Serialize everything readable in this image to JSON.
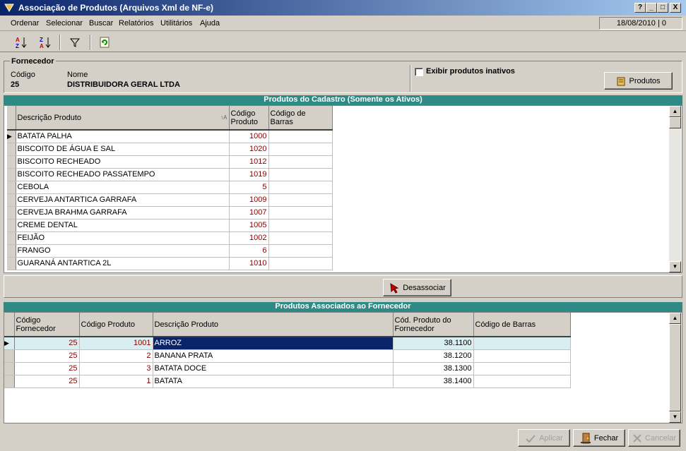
{
  "window": {
    "title": "Associação de Produtos (Arquivos Xml de NF-e)",
    "btn_help": "?",
    "btn_min": "_",
    "btn_max": "□",
    "btn_close": "X"
  },
  "menu": [
    "Ordenar",
    "Selecionar",
    "Buscar",
    "Relatórios",
    "Utilitários",
    "Ajuda"
  ],
  "status": {
    "date_user": "18/08/2010 | 0"
  },
  "fornecedor": {
    "group_label": "Fornecedor",
    "codigo_label": "Código",
    "codigo": "25",
    "nome_label": "Nome",
    "nome": "DISTRIBUIDORA GERAL LTDA",
    "inativos_label": "Exibir produtos inativos",
    "produtos_btn": "Produtos"
  },
  "cadastro": {
    "title": "Produtos do Cadastro (Somente os Ativos)",
    "headers": [
      "Descrição Produto",
      "Código Produto",
      "Código de Barras"
    ],
    "rows": [
      [
        "BATATA PALHA",
        "1000",
        ""
      ],
      [
        "BISCOITO DE ÁGUA E SAL",
        "1020",
        ""
      ],
      [
        "BISCOITO RECHEADO",
        "1012",
        ""
      ],
      [
        "BISCOITO RECHEADO PASSATEMPO",
        "1019",
        ""
      ],
      [
        "CEBOLA",
        "5",
        ""
      ],
      [
        "CERVEJA ANTARTICA GARRAFA",
        "1009",
        ""
      ],
      [
        "CERVEJA BRAHMA GARRAFA",
        "1007",
        ""
      ],
      [
        "CREME DENTAL",
        "1005",
        ""
      ],
      [
        "FEIJÃO",
        "1002",
        ""
      ],
      [
        "FRANGO",
        "6",
        ""
      ],
      [
        "GUARANÁ ANTARTICA 2L",
        "1010",
        ""
      ]
    ]
  },
  "desassociar_btn": "Desassociar",
  "associados": {
    "title": "Produtos Associados ao Fornecedor",
    "headers": [
      "Código Fornecedor",
      "Código Produto",
      "Descrição Produto",
      "Cód. Produto do Fornecedor",
      "Código de Barras"
    ],
    "rows": [
      [
        "25",
        "1001",
        "ARROZ",
        "38.1100",
        ""
      ],
      [
        "25",
        "2",
        "BANANA PRATA",
        "38.1200",
        ""
      ],
      [
        "25",
        "3",
        "BATATA DOCE",
        "38.1300",
        ""
      ],
      [
        "25",
        "1",
        "BATATA",
        "38.1400",
        ""
      ]
    ]
  },
  "footer": {
    "aplicar": "Aplicar",
    "fechar": "Fechar",
    "cancelar": "Cancelar"
  }
}
